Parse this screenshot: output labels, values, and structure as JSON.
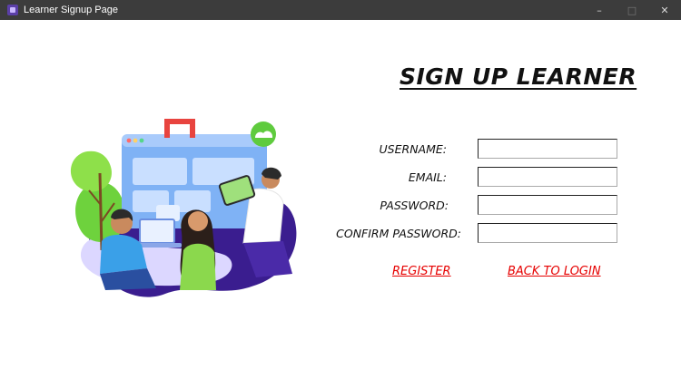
{
  "window": {
    "title": "Learner Signup Page",
    "controls": {
      "minimize_icon": "minimize-icon",
      "maximize_icon": "maximize-icon",
      "close_icon": "close-icon"
    }
  },
  "form": {
    "heading": "SIGN UP LEARNER",
    "fields": [
      {
        "label": "USERNAME:",
        "value": "",
        "placeholder": ""
      },
      {
        "label": "EMAIL:",
        "value": "",
        "placeholder": ""
      },
      {
        "label": "PASSWORD:",
        "value": "",
        "placeholder": ""
      },
      {
        "label": "CONFIRM PASSWORD:",
        "value": "",
        "placeholder": ""
      }
    ],
    "register_label": "REGISTER",
    "back_label": "BACK TO LOGIN"
  },
  "colors": {
    "titlebar": "#3c3c3c",
    "link": "#e60000",
    "background": "#ffffff"
  }
}
